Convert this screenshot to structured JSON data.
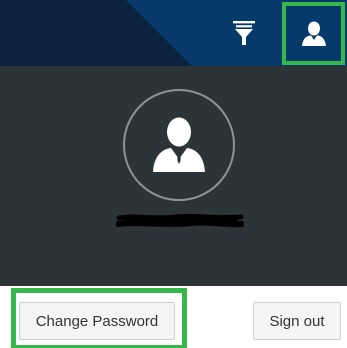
{
  "header": {
    "filter_icon": "filter-icon",
    "user_icon": "user-icon",
    "colors": {
      "bar": "#053a6b",
      "accent_dark": "#0c2340",
      "highlight": "#35b74a"
    }
  },
  "profile": {
    "avatar_icon": "user-silhouette-icon",
    "username": "",
    "panel_color": "#2c3438"
  },
  "actions": {
    "change_password_label": "Change Password",
    "sign_out_label": "Sign out"
  }
}
